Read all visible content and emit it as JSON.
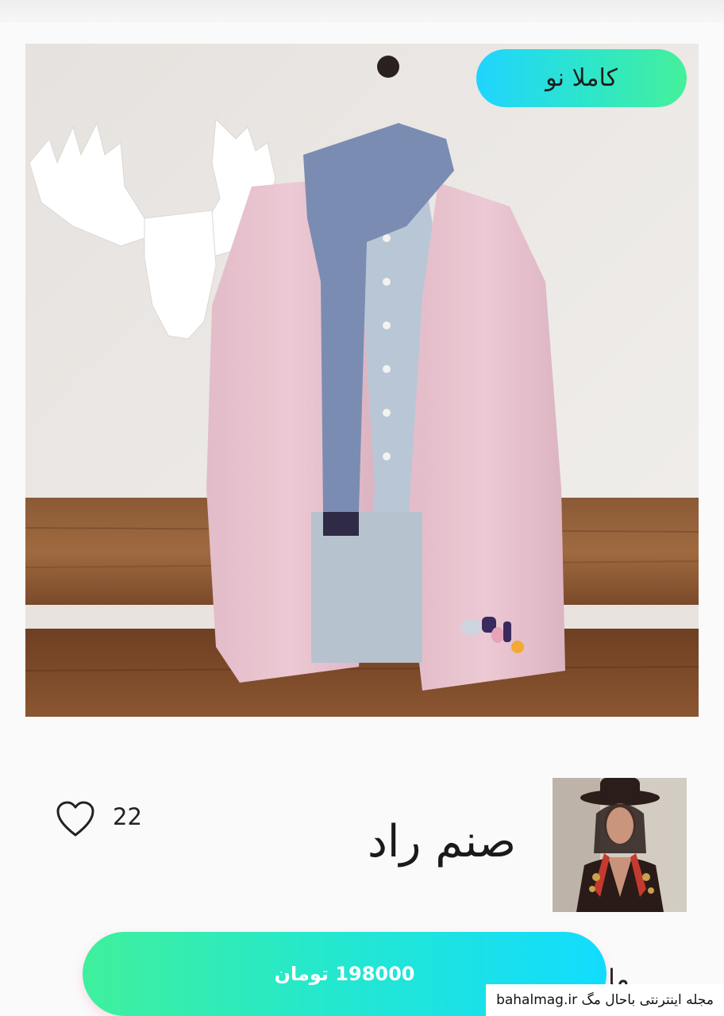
{
  "product": {
    "condition_badge": "کاملا نو",
    "image_description_icon": "coat-photo"
  },
  "seller": {
    "name": "صنم راد",
    "avatar_icon": "seller-avatar"
  },
  "likes": {
    "count": "22",
    "icon": "heart-outline-icon"
  },
  "price": {
    "label": "198000 تومان"
  },
  "partial_text": "ما",
  "watermark": {
    "text": "مجله اینترنتی باحال مگ bahalmag.ir"
  },
  "colors": {
    "badge_gradient": [
      "#1fd4ff",
      "#45f09a"
    ],
    "price_gradient": [
      "#3ff09c",
      "#12dcff"
    ]
  }
}
